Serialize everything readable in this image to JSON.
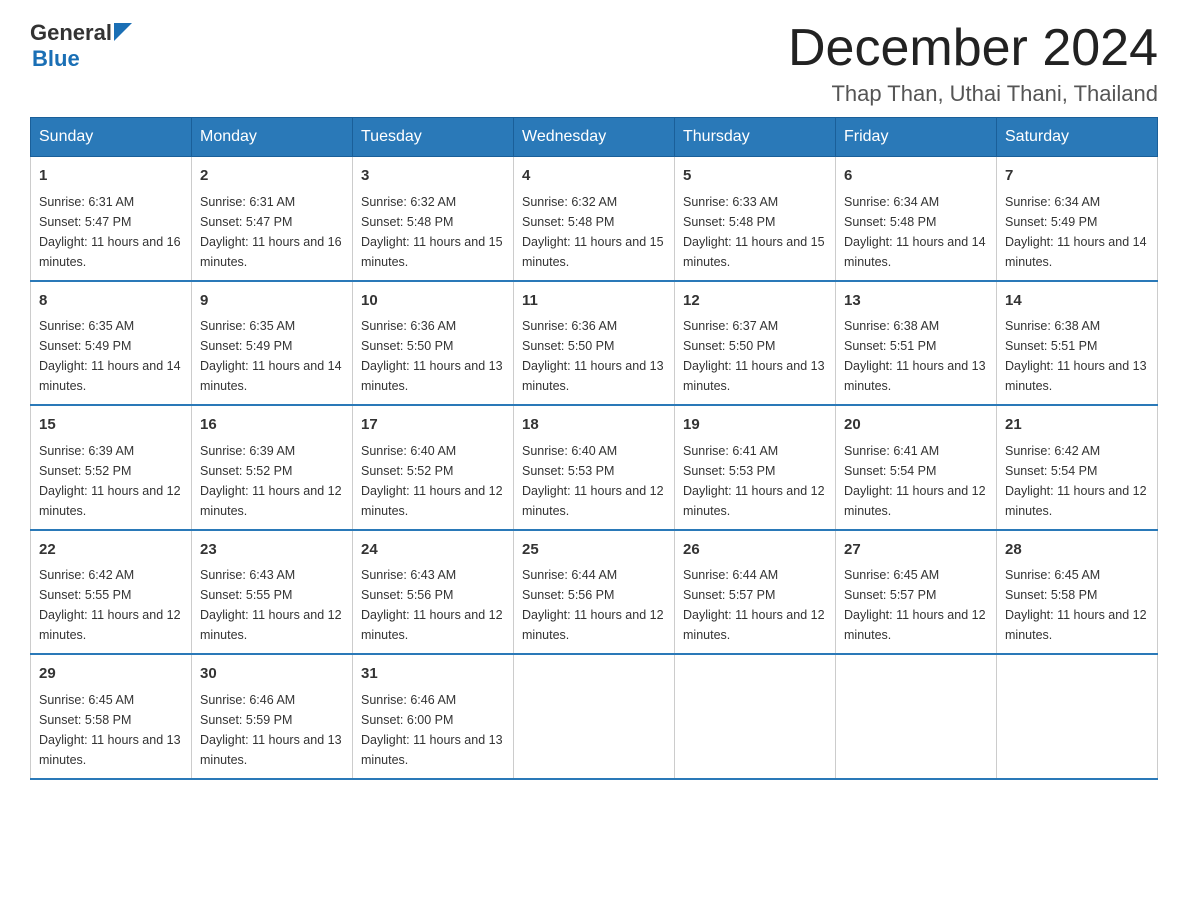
{
  "logo": {
    "general": "General",
    "blue": "Blue"
  },
  "header": {
    "title": "December 2024",
    "subtitle": "Thap Than, Uthai Thani, Thailand"
  },
  "days_of_week": [
    "Sunday",
    "Monday",
    "Tuesday",
    "Wednesday",
    "Thursday",
    "Friday",
    "Saturday"
  ],
  "weeks": [
    [
      {
        "date": "1",
        "sunrise": "6:31 AM",
        "sunset": "5:47 PM",
        "daylight": "11 hours and 16 minutes."
      },
      {
        "date": "2",
        "sunrise": "6:31 AM",
        "sunset": "5:47 PM",
        "daylight": "11 hours and 16 minutes."
      },
      {
        "date": "3",
        "sunrise": "6:32 AM",
        "sunset": "5:48 PM",
        "daylight": "11 hours and 15 minutes."
      },
      {
        "date": "4",
        "sunrise": "6:32 AM",
        "sunset": "5:48 PM",
        "daylight": "11 hours and 15 minutes."
      },
      {
        "date": "5",
        "sunrise": "6:33 AM",
        "sunset": "5:48 PM",
        "daylight": "11 hours and 15 minutes."
      },
      {
        "date": "6",
        "sunrise": "6:34 AM",
        "sunset": "5:48 PM",
        "daylight": "11 hours and 14 minutes."
      },
      {
        "date": "7",
        "sunrise": "6:34 AM",
        "sunset": "5:49 PM",
        "daylight": "11 hours and 14 minutes."
      }
    ],
    [
      {
        "date": "8",
        "sunrise": "6:35 AM",
        "sunset": "5:49 PM",
        "daylight": "11 hours and 14 minutes."
      },
      {
        "date": "9",
        "sunrise": "6:35 AM",
        "sunset": "5:49 PM",
        "daylight": "11 hours and 14 minutes."
      },
      {
        "date": "10",
        "sunrise": "6:36 AM",
        "sunset": "5:50 PM",
        "daylight": "11 hours and 13 minutes."
      },
      {
        "date": "11",
        "sunrise": "6:36 AM",
        "sunset": "5:50 PM",
        "daylight": "11 hours and 13 minutes."
      },
      {
        "date": "12",
        "sunrise": "6:37 AM",
        "sunset": "5:50 PM",
        "daylight": "11 hours and 13 minutes."
      },
      {
        "date": "13",
        "sunrise": "6:38 AM",
        "sunset": "5:51 PM",
        "daylight": "11 hours and 13 minutes."
      },
      {
        "date": "14",
        "sunrise": "6:38 AM",
        "sunset": "5:51 PM",
        "daylight": "11 hours and 13 minutes."
      }
    ],
    [
      {
        "date": "15",
        "sunrise": "6:39 AM",
        "sunset": "5:52 PM",
        "daylight": "11 hours and 12 minutes."
      },
      {
        "date": "16",
        "sunrise": "6:39 AM",
        "sunset": "5:52 PM",
        "daylight": "11 hours and 12 minutes."
      },
      {
        "date": "17",
        "sunrise": "6:40 AM",
        "sunset": "5:52 PM",
        "daylight": "11 hours and 12 minutes."
      },
      {
        "date": "18",
        "sunrise": "6:40 AM",
        "sunset": "5:53 PM",
        "daylight": "11 hours and 12 minutes."
      },
      {
        "date": "19",
        "sunrise": "6:41 AM",
        "sunset": "5:53 PM",
        "daylight": "11 hours and 12 minutes."
      },
      {
        "date": "20",
        "sunrise": "6:41 AM",
        "sunset": "5:54 PM",
        "daylight": "11 hours and 12 minutes."
      },
      {
        "date": "21",
        "sunrise": "6:42 AM",
        "sunset": "5:54 PM",
        "daylight": "11 hours and 12 minutes."
      }
    ],
    [
      {
        "date": "22",
        "sunrise": "6:42 AM",
        "sunset": "5:55 PM",
        "daylight": "11 hours and 12 minutes."
      },
      {
        "date": "23",
        "sunrise": "6:43 AM",
        "sunset": "5:55 PM",
        "daylight": "11 hours and 12 minutes."
      },
      {
        "date": "24",
        "sunrise": "6:43 AM",
        "sunset": "5:56 PM",
        "daylight": "11 hours and 12 minutes."
      },
      {
        "date": "25",
        "sunrise": "6:44 AM",
        "sunset": "5:56 PM",
        "daylight": "11 hours and 12 minutes."
      },
      {
        "date": "26",
        "sunrise": "6:44 AM",
        "sunset": "5:57 PM",
        "daylight": "11 hours and 12 minutes."
      },
      {
        "date": "27",
        "sunrise": "6:45 AM",
        "sunset": "5:57 PM",
        "daylight": "11 hours and 12 minutes."
      },
      {
        "date": "28",
        "sunrise": "6:45 AM",
        "sunset": "5:58 PM",
        "daylight": "11 hours and 12 minutes."
      }
    ],
    [
      {
        "date": "29",
        "sunrise": "6:45 AM",
        "sunset": "5:58 PM",
        "daylight": "11 hours and 13 minutes."
      },
      {
        "date": "30",
        "sunrise": "6:46 AM",
        "sunset": "5:59 PM",
        "daylight": "11 hours and 13 minutes."
      },
      {
        "date": "31",
        "sunrise": "6:46 AM",
        "sunset": "6:00 PM",
        "daylight": "11 hours and 13 minutes."
      },
      {
        "date": "",
        "sunrise": "",
        "sunset": "",
        "daylight": ""
      },
      {
        "date": "",
        "sunrise": "",
        "sunset": "",
        "daylight": ""
      },
      {
        "date": "",
        "sunrise": "",
        "sunset": "",
        "daylight": ""
      },
      {
        "date": "",
        "sunrise": "",
        "sunset": "",
        "daylight": ""
      }
    ]
  ]
}
